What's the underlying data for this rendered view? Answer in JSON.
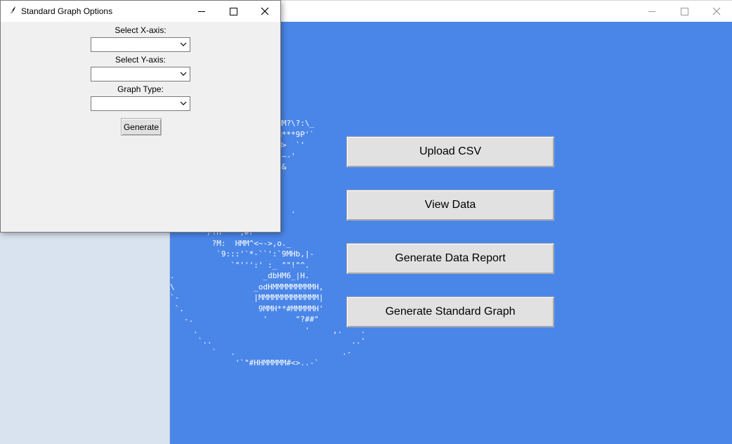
{
  "main_window": {
    "buttons": {
      "upload_csv": "Upload CSV",
      "view_data": "View Data",
      "generate_report": "Generate Data Report",
      "generate_standard_graph": "Generate Standard Graph"
    },
    "ascii_art": "                   MMMMMM?\\?:\\_\n                   MMMMH***9P'`\n                   MMMMM>  `'\n                   MH*'|~-'\n                    H._,&\n                      `\"\n                    _\n\n                          .\n                   \n  `'    /?H    ,#r `'\n         ?M:  HMM^<~->,o._\n          `9:::'`*-``':`9MHb,|-\n             `\"''':' :_ \"\"!\"^.\n.                   _dbHM6_|H.\n\\                 _odHMMMMMMMMMH,\n`-                |MMMMMMMMMMMMM|\n `.                9MMH**#MMMMMH'\n   -.               '      \"?##\"\n     .                       '     ,.    .\n      `..                              ..'\n         `   .                       .-\n              '`\"#HHMMMMM#<>..-`",
    "colors": {
      "left_panel": "#d9e3f0",
      "right_panel": "#4a86e8",
      "button_bg": "#e1e1e1"
    },
    "icons": [
      "minimize-icon",
      "maximize-icon",
      "close-icon"
    ]
  },
  "dialog": {
    "title": "Standard Graph Options",
    "icon": "feather-icon",
    "x_axis_label": "Select X-axis:",
    "x_axis_value": "",
    "y_axis_label": "Select Y-axis:",
    "y_axis_value": "",
    "graph_type_label": "Graph Type:",
    "graph_type_value": "",
    "generate_label": "Generate"
  }
}
